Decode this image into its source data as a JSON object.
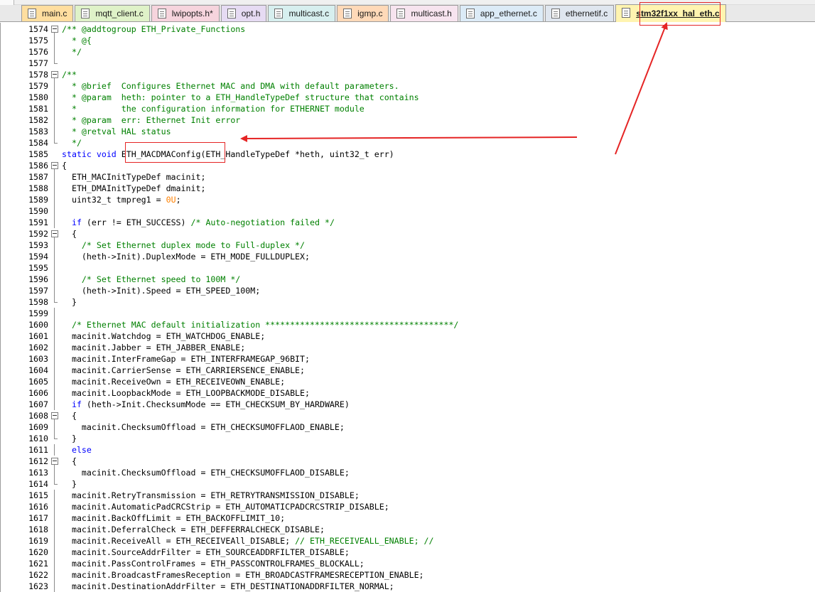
{
  "tabs": [
    {
      "label": "main.c",
      "color": "#ffde9f"
    },
    {
      "label": "mqtt_client.c",
      "color": "#dff2c8"
    },
    {
      "label": "lwipopts.h*",
      "color": "#f6d4dd"
    },
    {
      "label": "opt.h",
      "color": "#e6dbf3"
    },
    {
      "label": "multicast.c",
      "color": "#d7efef"
    },
    {
      "label": "igmp.c",
      "color": "#ffd9b8"
    },
    {
      "label": "multicast.h",
      "color": "#f7e4ef"
    },
    {
      "label": "app_ethernet.c",
      "color": "#dcebf7"
    },
    {
      "label": "ethernetif.c",
      "color": "#dfe6ef"
    },
    {
      "label": "stm32f1xx_hal_eth.c",
      "color": "#fff4b0",
      "active": true
    }
  ],
  "editor": {
    "lines": [
      {
        "n": "1574",
        "fold": "start",
        "parts": [
          [
            "c",
            "/** @addtogroup ETH_Private_Functions"
          ]
        ]
      },
      {
        "n": "1575",
        "fold": "guide",
        "parts": [
          [
            "c",
            "  * @{"
          ]
        ]
      },
      {
        "n": "1576",
        "fold": "guide",
        "parts": [
          [
            "c",
            "  */"
          ]
        ]
      },
      {
        "n": "1577",
        "fold": "end",
        "parts": []
      },
      {
        "n": "1578",
        "fold": "start",
        "parts": [
          [
            "c",
            "/**"
          ]
        ]
      },
      {
        "n": "1579",
        "fold": "guide",
        "parts": [
          [
            "c",
            "  * @brief  Configures Ethernet MAC and DMA with default parameters."
          ]
        ]
      },
      {
        "n": "1580",
        "fold": "guide",
        "parts": [
          [
            "c",
            "  * @param  heth: pointer to a ETH_HandleTypeDef structure that contains"
          ]
        ]
      },
      {
        "n": "1581",
        "fold": "guide",
        "parts": [
          [
            "c",
            "  *         the configuration information for ETHERNET module"
          ]
        ]
      },
      {
        "n": "1582",
        "fold": "guide",
        "parts": [
          [
            "c",
            "  * @param  err: Ethernet Init error"
          ]
        ]
      },
      {
        "n": "1583",
        "fold": "guide",
        "parts": [
          [
            "c",
            "  * @retval HAL status"
          ]
        ]
      },
      {
        "n": "1584",
        "fold": "end",
        "parts": [
          [
            "c",
            "  */"
          ]
        ]
      },
      {
        "n": "1585",
        "fold": "none",
        "parts": [
          [
            "k",
            "static void "
          ],
          [
            "t",
            "ETH_MACDMAConfig(ETH_HandleTypeDef *heth, uint32_t err)"
          ]
        ]
      },
      {
        "n": "1586",
        "fold": "start",
        "parts": [
          [
            "t",
            "{"
          ]
        ]
      },
      {
        "n": "1587",
        "fold": "guide",
        "parts": [
          [
            "t",
            "  ETH_MACInitTypeDef macinit;"
          ]
        ]
      },
      {
        "n": "1588",
        "fold": "guide",
        "parts": [
          [
            "t",
            "  ETH_DMAInitTypeDef dmainit;"
          ]
        ]
      },
      {
        "n": "1589",
        "fold": "guide",
        "parts": [
          [
            "t",
            "  uint32_t tmpreg1 = "
          ],
          [
            "n",
            "0U"
          ],
          [
            "t",
            ";"
          ]
        ]
      },
      {
        "n": "1590",
        "fold": "guide",
        "parts": []
      },
      {
        "n": "1591",
        "fold": "guide",
        "parts": [
          [
            "k",
            "  if "
          ],
          [
            "t",
            "(err != ETH_SUCCESS) "
          ],
          [
            "c",
            "/* Auto-negotiation failed */"
          ]
        ]
      },
      {
        "n": "1592",
        "fold": "start",
        "parts": [
          [
            "t",
            "  {"
          ]
        ]
      },
      {
        "n": "1593",
        "fold": "guide",
        "parts": [
          [
            "c",
            "    /* Set Ethernet duplex mode to Full-duplex */"
          ]
        ]
      },
      {
        "n": "1594",
        "fold": "guide",
        "parts": [
          [
            "t",
            "    (heth->Init).DuplexMode = ETH_MODE_FULLDUPLEX;"
          ]
        ]
      },
      {
        "n": "1595",
        "fold": "guide",
        "parts": []
      },
      {
        "n": "1596",
        "fold": "guide",
        "parts": [
          [
            "c",
            "    /* Set Ethernet speed to 100M */"
          ]
        ]
      },
      {
        "n": "1597",
        "fold": "guide",
        "parts": [
          [
            "t",
            "    (heth->Init).Speed = ETH_SPEED_100M;"
          ]
        ]
      },
      {
        "n": "1598",
        "fold": "end",
        "parts": [
          [
            "t",
            "  }"
          ]
        ]
      },
      {
        "n": "1599",
        "fold": "guide",
        "parts": []
      },
      {
        "n": "1600",
        "fold": "guide",
        "parts": [
          [
            "c",
            "  /* Ethernet MAC default initialization **************************************/"
          ]
        ]
      },
      {
        "n": "1601",
        "fold": "guide",
        "parts": [
          [
            "t",
            "  macinit.Watchdog = ETH_WATCHDOG_ENABLE;"
          ]
        ]
      },
      {
        "n": "1602",
        "fold": "guide",
        "parts": [
          [
            "t",
            "  macinit.Jabber = ETH_JABBER_ENABLE;"
          ]
        ]
      },
      {
        "n": "1603",
        "fold": "guide",
        "parts": [
          [
            "t",
            "  macinit.InterFrameGap = ETH_INTERFRAMEGAP_96BIT;"
          ]
        ]
      },
      {
        "n": "1604",
        "fold": "guide",
        "parts": [
          [
            "t",
            "  macinit.CarrierSense = ETH_CARRIERSENCE_ENABLE;"
          ]
        ]
      },
      {
        "n": "1605",
        "fold": "guide",
        "parts": [
          [
            "t",
            "  macinit.ReceiveOwn = ETH_RECEIVEOWN_ENABLE;"
          ]
        ]
      },
      {
        "n": "1606",
        "fold": "guide",
        "parts": [
          [
            "t",
            "  macinit.LoopbackMode = ETH_LOOPBACKMODE_DISABLE;"
          ]
        ]
      },
      {
        "n": "1607",
        "fold": "guide",
        "parts": [
          [
            "k",
            "  if "
          ],
          [
            "t",
            "(heth->Init.ChecksumMode == ETH_CHECKSUM_BY_HARDWARE)"
          ]
        ]
      },
      {
        "n": "1608",
        "fold": "start",
        "parts": [
          [
            "t",
            "  {"
          ]
        ]
      },
      {
        "n": "1609",
        "fold": "guide",
        "parts": [
          [
            "t",
            "    macinit.ChecksumOffload = ETH_CHECKSUMOFFLAOD_ENABLE;"
          ]
        ]
      },
      {
        "n": "1610",
        "fold": "end",
        "parts": [
          [
            "t",
            "  }"
          ]
        ]
      },
      {
        "n": "1611",
        "fold": "guide",
        "parts": [
          [
            "k",
            "  else"
          ]
        ]
      },
      {
        "n": "1612",
        "fold": "start",
        "parts": [
          [
            "t",
            "  {"
          ]
        ]
      },
      {
        "n": "1613",
        "fold": "guide",
        "parts": [
          [
            "t",
            "    macinit.ChecksumOffload = ETH_CHECKSUMOFFLAOD_DISABLE;"
          ]
        ]
      },
      {
        "n": "1614",
        "fold": "end",
        "parts": [
          [
            "t",
            "  }"
          ]
        ]
      },
      {
        "n": "1615",
        "fold": "guide",
        "parts": [
          [
            "t",
            "  macinit.RetryTransmission = ETH_RETRYTRANSMISSION_DISABLE;"
          ]
        ]
      },
      {
        "n": "1616",
        "fold": "guide",
        "parts": [
          [
            "t",
            "  macinit.AutomaticPadCRCStrip = ETH_AUTOMATICPADCRCSTRIP_DISABLE;"
          ]
        ]
      },
      {
        "n": "1617",
        "fold": "guide",
        "parts": [
          [
            "t",
            "  macinit.BackOffLimit = ETH_BACKOFFLIMIT_10;"
          ]
        ]
      },
      {
        "n": "1618",
        "fold": "guide",
        "parts": [
          [
            "t",
            "  macinit.DeferralCheck = ETH_DEFFERRALCHECK_DISABLE;"
          ]
        ]
      },
      {
        "n": "1619",
        "fold": "guide",
        "parts": [
          [
            "t",
            "  macinit.ReceiveAll = ETH_RECEIVEAll_DISABLE; "
          ],
          [
            "c",
            "// ETH_RECEIVEALL_ENABLE; //"
          ]
        ]
      },
      {
        "n": "1620",
        "fold": "guide",
        "parts": [
          [
            "t",
            "  macinit.SourceAddrFilter = ETH_SOURCEADDRFILTER_DISABLE;"
          ]
        ]
      },
      {
        "n": "1621",
        "fold": "guide",
        "parts": [
          [
            "t",
            "  macinit.PassControlFrames = ETH_PASSCONTROLFRAMES_BLOCKALL;"
          ]
        ]
      },
      {
        "n": "1622",
        "fold": "guide",
        "parts": [
          [
            "t",
            "  macinit.BroadcastFramesReception = ETH_BROADCASTFRAMESRECEPTION_ENABLE;"
          ]
        ]
      },
      {
        "n": "1623",
        "fold": "guide",
        "parts": [
          [
            "t",
            "  macinit.DestinationAddrFilter = ETH_DESTINATIONADDRFILTER_NORMAL;"
          ]
        ]
      }
    ]
  },
  "colors": {
    "comment": "#008000",
    "keyword": "#0000ff",
    "number": "#ff8000",
    "annotation": "#e52525"
  }
}
